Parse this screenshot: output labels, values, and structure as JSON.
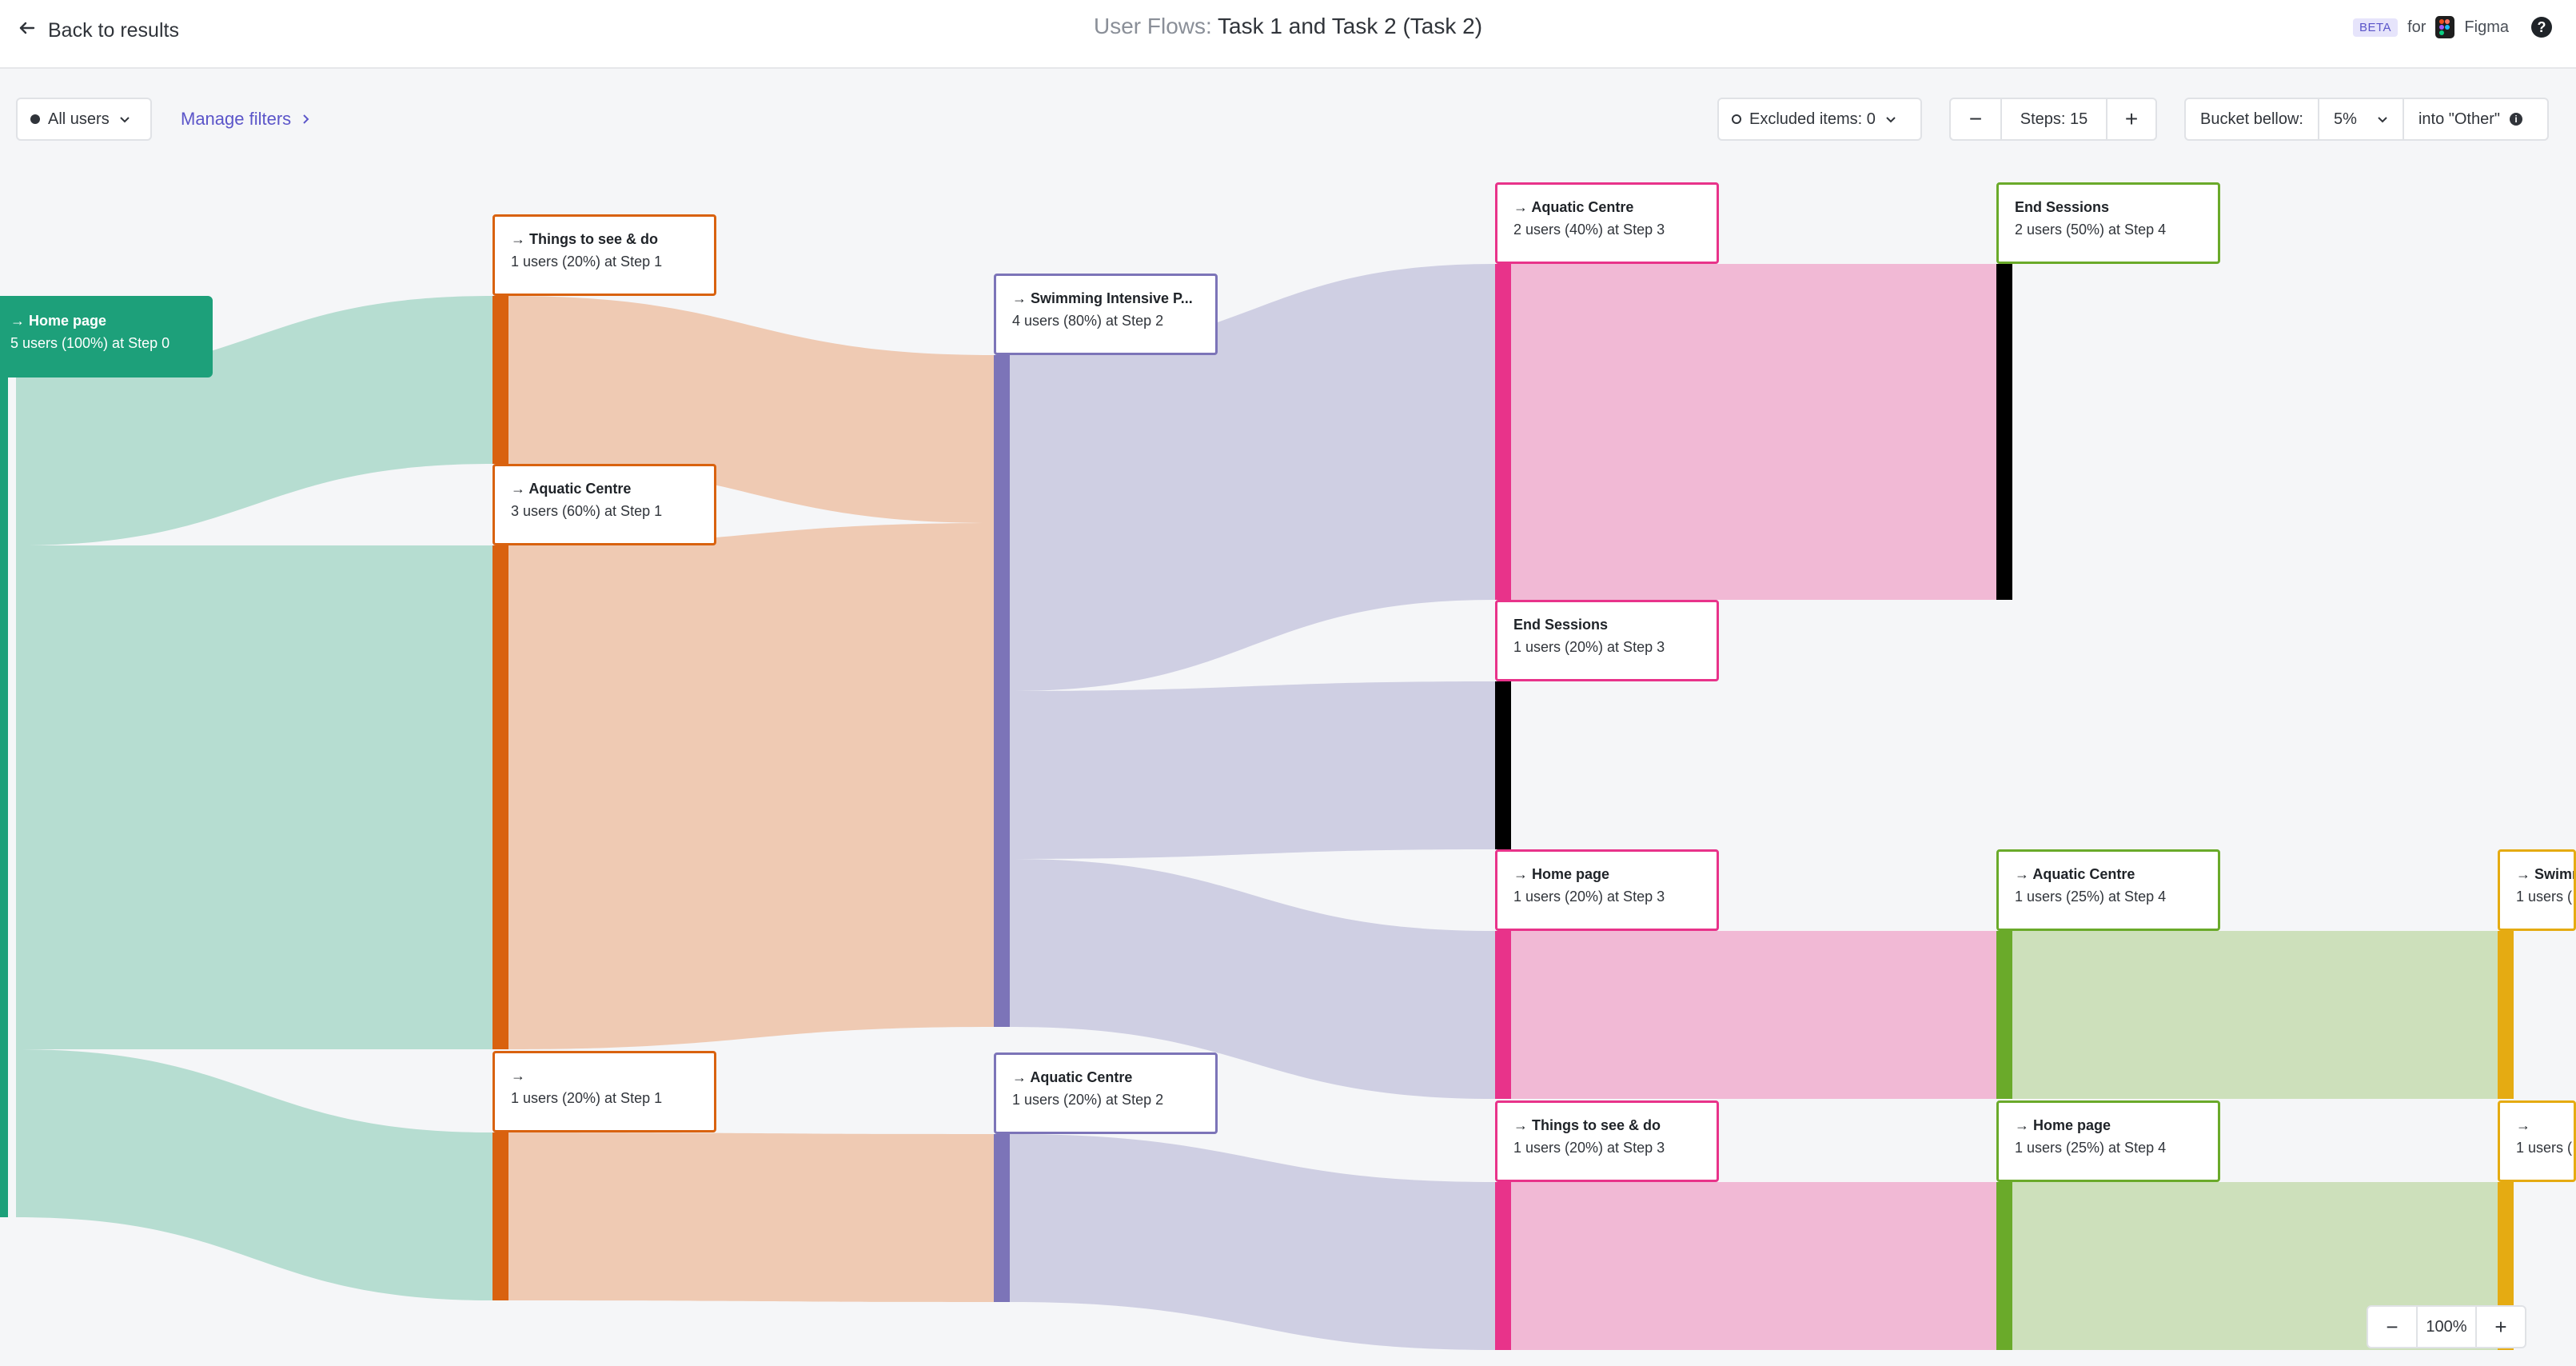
{
  "header": {
    "back_label": "Back to results",
    "title_prefix": "User Flows:",
    "title_main": "Task 1 and Task 2 (Task 2)",
    "beta_badge": "BETA",
    "for_text": "for",
    "integration": "Figma"
  },
  "toolbar": {
    "segment_label": "All users",
    "manage_filters": "Manage filters",
    "excluded_items": "Excluded items: 0",
    "steps_label": "Steps: 15",
    "bucket_label": "Bucket bellow:",
    "bucket_value": "5%",
    "into_other": "into \"Other\""
  },
  "zoom": {
    "value": "100%"
  },
  "colors": {
    "step0": "#1da07a",
    "step1": "#d9620f",
    "step2": "#7c74b8",
    "step3": "#e8338a",
    "step4": "#6aaa2a",
    "step5": "#e5ab12",
    "end": "#000000"
  },
  "flow": {
    "nodes": [
      {
        "id": "n0",
        "arrow": true,
        "title": "Home page",
        "subtitle": "5 users (100%) at Step 0",
        "step": 0
      },
      {
        "id": "n1a",
        "arrow": true,
        "title": "Things to see & do",
        "subtitle": "1 users (20%) at Step 1",
        "step": 1
      },
      {
        "id": "n1b",
        "arrow": true,
        "title": "Aquatic Centre",
        "subtitle": "3 users (60%) at Step 1",
        "step": 1
      },
      {
        "id": "n1c",
        "arrow": true,
        "title": "",
        "subtitle": "1 users (20%) at Step 1",
        "step": 1
      },
      {
        "id": "n2a",
        "arrow": true,
        "title": "Swimming Intensive P...",
        "subtitle": "4 users (80%) at Step 2",
        "step": 2
      },
      {
        "id": "n2b",
        "arrow": true,
        "title": "Aquatic Centre",
        "subtitle": "1 users (20%) at Step 2",
        "step": 2
      },
      {
        "id": "n3a",
        "arrow": true,
        "title": "Aquatic Centre",
        "subtitle": "2 users (40%) at Step 3",
        "step": 3
      },
      {
        "id": "n3b",
        "arrow": false,
        "title": "End Sessions",
        "subtitle": "1 users (20%) at Step 3",
        "step": 3,
        "end": true
      },
      {
        "id": "n3c",
        "arrow": true,
        "title": "Home page",
        "subtitle": "1 users (20%) at Step 3",
        "step": 3
      },
      {
        "id": "n3d",
        "arrow": true,
        "title": "Things to see & do",
        "subtitle": "1 users (20%) at Step 3",
        "step": 3
      },
      {
        "id": "n4a",
        "arrow": false,
        "title": "End Sessions",
        "subtitle": "2 users (50%) at Step 4",
        "step": 4,
        "end": true
      },
      {
        "id": "n4b",
        "arrow": true,
        "title": "Aquatic Centre",
        "subtitle": "1 users (25%) at Step 4",
        "step": 4
      },
      {
        "id": "n4c",
        "arrow": true,
        "title": "Home page",
        "subtitle": "1 users (25%) at Step 4",
        "step": 4
      },
      {
        "id": "n5a",
        "arrow": true,
        "title": "Swimm",
        "subtitle": "1 users (",
        "step": 5
      },
      {
        "id": "n5b",
        "arrow": true,
        "title": "",
        "subtitle": "1 users (",
        "step": 5
      }
    ],
    "links": [
      {
        "from": "n0",
        "to": "n1a",
        "users": 1
      },
      {
        "from": "n0",
        "to": "n1b",
        "users": 3
      },
      {
        "from": "n0",
        "to": "n1c",
        "users": 1
      },
      {
        "from": "n1a",
        "to": "n2a",
        "users": 1
      },
      {
        "from": "n1b",
        "to": "n2a",
        "users": 3
      },
      {
        "from": "n1c",
        "to": "n2b",
        "users": 1
      },
      {
        "from": "n2a",
        "to": "n3a",
        "users": 2
      },
      {
        "from": "n2a",
        "to": "n3b",
        "users": 1
      },
      {
        "from": "n2a",
        "to": "n3c",
        "users": 1
      },
      {
        "from": "n2b",
        "to": "n3d",
        "users": 1
      },
      {
        "from": "n3a",
        "to": "n4a",
        "users": 2
      },
      {
        "from": "n3c",
        "to": "n4b",
        "users": 1
      },
      {
        "from": "n3d",
        "to": "n4c",
        "users": 1
      },
      {
        "from": "n4b",
        "to": "n5a",
        "users": 1
      },
      {
        "from": "n4c",
        "to": "n5b",
        "users": 1
      }
    ]
  }
}
